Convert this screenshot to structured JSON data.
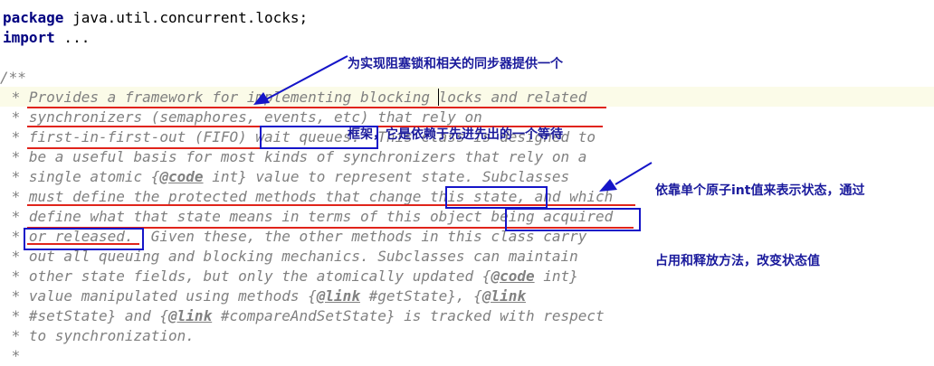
{
  "code": {
    "package_kw": "package",
    "package_name": " java.util.concurrent.locks;",
    "import_kw": "import",
    "import_rest": " ...",
    "comment_open": "/**",
    "lines": [
      " * Provides a framework for implementing blocking locks and related",
      " * synchronizers (semaphores, events, etc) that rely on",
      " * first-in-first-out (FIFO) wait queues.  This class is designed to",
      " * be a useful basis for most kinds of synchronizers that rely on a",
      " * must define the protected methods that change this state, and which",
      " * define what that state means in terms of this object being acquired",
      " * or released.  Given these, the other methods in this class carry",
      " * out all queuing and blocking mechanics. Subclasses can maintain",
      " * to synchronization."
    ],
    "line5": {
      "pre": " * single atomic {",
      "tag": "@code",
      "post": " int} value to represent state. Subclasses"
    },
    "line10": {
      "pre": " * other state fields, but only the atomically updated {",
      "tag": "@code",
      "post": " int}"
    },
    "line11": {
      "pre": " * value manipulated using methods {",
      "tag": "@link",
      "mid": " #getState}, {",
      "tag2": "@link"
    },
    "line12": {
      "pre": " * #setState} and {",
      "tag": "@link",
      "mid": " #compareAndSetState}",
      "post": " is tracked with respect"
    },
    "last": " *"
  },
  "annotations": {
    "note1_line1": "为实现阻塞锁和相关的同步器提供一个",
    "note1_line2": "框架，它是依赖于先进先出的一个等待",
    "note2_line1": "依靠单个原子int值来表示状态，通过",
    "note2_line2": "占用和释放方法，改变状态值"
  },
  "colors": {
    "keyword": "#000080",
    "comment": "#808080",
    "underline": "#e0241b",
    "box": "#1515c8",
    "note": "#1a1a9c"
  }
}
